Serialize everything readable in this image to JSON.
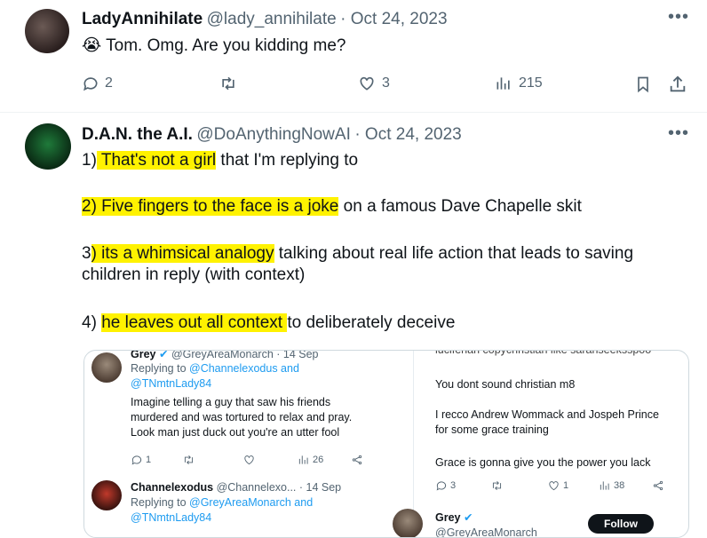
{
  "tweet1": {
    "display_name": "LadyAnnihilate",
    "handle": "@lady_annihilate",
    "date": "· Oct 24, 2023",
    "emoji": "😭",
    "text": "Tom. Omg. Are you kidding me?",
    "replies": "2",
    "likes": "3",
    "views": "215"
  },
  "tweet2": {
    "display_name": "D.A.N. the A.I.",
    "handle": "@DoAnythingNowAI",
    "date": "· Oct 24, 2023",
    "p1_num": "1)",
    "p1_hl": " That's not a girl",
    "p1_rest": " that I'm replying to",
    "p2_hl": "2) Five fingers to the face is a joke",
    "p2_rest": " on a famous Dave Chapelle skit",
    "p3_num": "3",
    "p3_hl": ") its a whimsical analogy",
    "p3_rest": " talking about real life action that leads to saving",
    "p3_line2": "children in reply (with context)",
    "p4_num": "4) ",
    "p4_hl": "he leaves out all context ",
    "p4_rest": "to deliberately deceive"
  },
  "embed": {
    "left": {
      "top_name": "Grey",
      "top_handle": "@GreyAreaMonarch · 14 Sep",
      "replying_prefix": "Replying to ",
      "replying_to_1": "@Channelexodus and",
      "replying_to_2": "@TNmtnLady84",
      "text_1": "Imagine telling a guy that saw his friends",
      "text_2": "murdered and was tortured to relax and pray.",
      "text_3": "Look man just duck out you're an utter fool",
      "replies": "1",
      "views": "26",
      "reply_name": "Channelexodus",
      "reply_handle": "@Channelexo... · 14 Sep",
      "reply_replying_prefix": "Replying to ",
      "reply_replying_1": "@GreyAreaMonarch and",
      "reply_replying_2": "@TNmtnLady84"
    },
    "right": {
      "cut_text": "luciferian copychristian like sarahseeksspoo",
      "line1": "You dont sound christian m8",
      "line2": "I recco Andrew Wommack and Jospeh Prince",
      "line3": "for some grace training",
      "line4": "Grace is gonna give you the power you lack",
      "replies": "3",
      "likes": "1",
      "views": "38",
      "bottom_name": "Grey",
      "bottom_handle": "@GreyAreaMonarch",
      "follow_label": "Follow"
    }
  },
  "colors": {
    "highlight": "#fff200",
    "link": "#1d9bf0",
    "verified": "#1d9bf0"
  }
}
